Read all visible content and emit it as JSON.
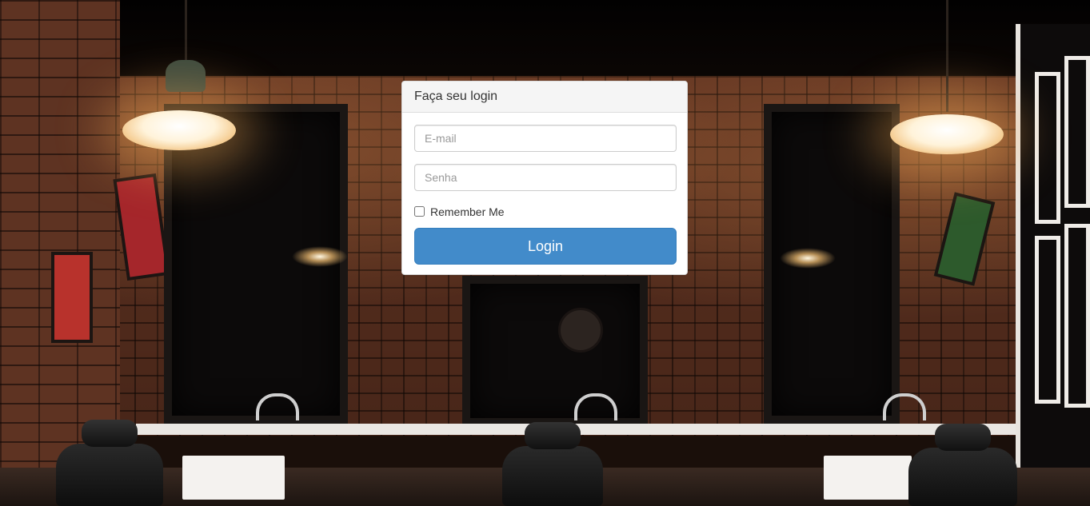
{
  "login": {
    "title": "Faça seu login",
    "email_placeholder": "E-mail",
    "email_value": "",
    "password_placeholder": "Senha",
    "password_value": "",
    "remember_label": "Remember Me",
    "remember_checked": false,
    "submit_label": "Login"
  },
  "colors": {
    "primary_button": "#428bca",
    "panel_heading_bg": "#f5f5f5",
    "panel_border": "#dddddd"
  }
}
